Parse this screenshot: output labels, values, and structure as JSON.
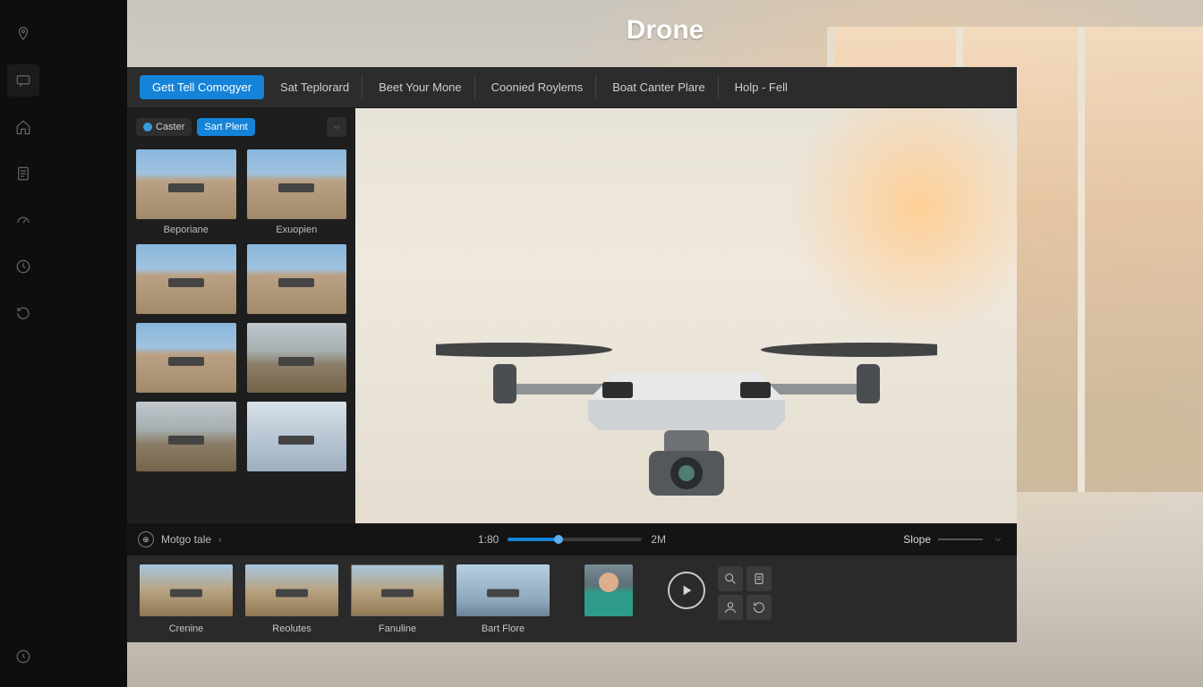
{
  "app": {
    "title": "Drone"
  },
  "rail_icons": [
    "location",
    "chat",
    "home",
    "document",
    "gauge",
    "clock",
    "loop",
    "history"
  ],
  "tabs": [
    {
      "label": "Gett Tell Comogyer",
      "active": true
    },
    {
      "label": "Sat Teplorard"
    },
    {
      "label": "Beet Your Mone"
    },
    {
      "label": "Coonied Roylems"
    },
    {
      "label": "Boat Canter Plare"
    },
    {
      "label": "Holp - Fell"
    }
  ],
  "filter": {
    "pill1": "Caster",
    "pill2": "Sart Plent"
  },
  "thumbs": [
    {
      "label": "Beporiane",
      "style": "default"
    },
    {
      "label": "Exuopien",
      "style": "default"
    },
    {
      "label": "",
      "style": "default"
    },
    {
      "label": "",
      "style": "default"
    },
    {
      "label": "",
      "style": "default"
    },
    {
      "label": "",
      "style": "rock"
    },
    {
      "label": "",
      "style": "rock"
    },
    {
      "label": "",
      "style": "cloud"
    }
  ],
  "timeline": {
    "info_label": "Motgo tale",
    "start": "1:80",
    "end": "2M",
    "slope_label": "Slope"
  },
  "clips": [
    {
      "label": "Crenine",
      "style": "default"
    },
    {
      "label": "Reolutes",
      "style": "default"
    },
    {
      "label": "Fanuline",
      "style": "default",
      "bordered": true
    },
    {
      "label": "Bart Flore",
      "style": "sky"
    }
  ],
  "strip_buttons": [
    "search",
    "doc",
    "user",
    "refresh"
  ]
}
